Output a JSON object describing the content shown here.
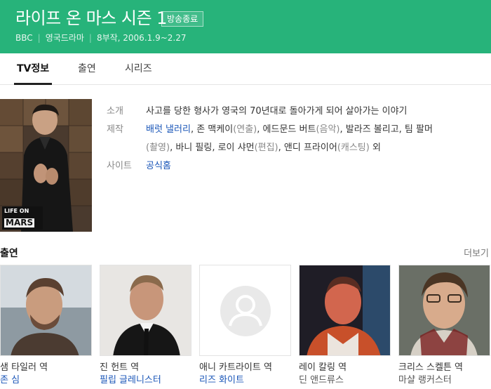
{
  "show": {
    "title": "라이프 온 마스 시즌 1",
    "status_badge": "방송종료",
    "broadcaster": "BBC",
    "genre": "영국드라마",
    "episodes_dates": "8부작, 2006.1.9~2.27"
  },
  "tabs": [
    {
      "label": "TV정보",
      "active": true
    },
    {
      "label": "출연",
      "active": false
    },
    {
      "label": "시리즈",
      "active": false
    }
  ],
  "poster": {
    "logo_line1": "LIFE ON",
    "logo_line2": "MARS"
  },
  "info": {
    "intro_label": "소개",
    "intro_text": "사고를 당한 형사가 영국의 70년대로 돌아가게 되어 살아가는 이야기",
    "production_label": "제작",
    "production_line1": [
      {
        "text": "배럿 낼러리",
        "link": true
      },
      {
        "text": ", 존 맥케이",
        "link": false
      },
      {
        "text": "(연출)",
        "sub": true
      },
      {
        "text": ", 에드문드 버트",
        "link": false
      },
      {
        "text": "(음악)",
        "sub": true
      },
      {
        "text": ", 발라즈 볼리고, 팀 팔머",
        "link": false
      }
    ],
    "production_line2": [
      {
        "text": "(촬영)",
        "sub": true
      },
      {
        "text": ", 바니 필링, 로이 샤먼",
        "link": false
      },
      {
        "text": "(편집)",
        "sub": true
      },
      {
        "text": ", 앤디 프라이어",
        "link": false
      },
      {
        "text": "(캐스팅)",
        "sub": true
      },
      {
        "text": " 외",
        "link": false
      }
    ],
    "site_label": "사이트",
    "site_link": "공식홈"
  },
  "cast_section": {
    "title": "출연",
    "more": "더보기",
    "members": [
      {
        "role": "샘 타일러 역",
        "actor": "존 심",
        "actor_link": true
      },
      {
        "role": "진 헌트 역",
        "actor": "필립 글레니스터",
        "actor_link": true
      },
      {
        "role": "애니 카트라이트 역",
        "actor": "리즈 화이트",
        "actor_link": true
      },
      {
        "role": "레이 칼링 역",
        "actor": "딘 앤드류스",
        "actor_link": false
      },
      {
        "role": "크리스 스켈튼 역",
        "actor": "마샬 랭커스터",
        "actor_link": false
      }
    ]
  },
  "colors": {
    "header_bg": "#27b37a",
    "link": "#1a56b8"
  }
}
